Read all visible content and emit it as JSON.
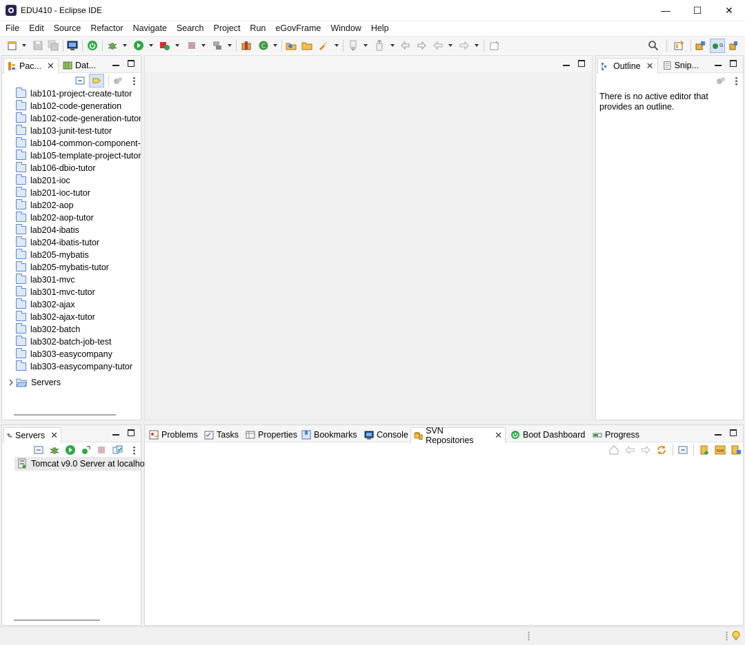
{
  "window": {
    "title": "EDU410 - Eclipse IDE",
    "minimize": "—",
    "maximize": "☐",
    "close": "✕"
  },
  "menu": [
    "File",
    "Edit",
    "Source",
    "Refactor",
    "Navigate",
    "Search",
    "Project",
    "Run",
    "eGovFrame",
    "Window",
    "Help"
  ],
  "explorer": {
    "tabs": [
      {
        "label": "Pac...",
        "icon": "package-explorer-icon"
      },
      {
        "label": "Dat...",
        "icon": "data-source-icon"
      }
    ],
    "projects": [
      "lab101-project-create-tutor",
      "lab102-code-generation",
      "lab102-code-generation-tutor",
      "lab103-junit-test-tutor",
      "lab104-common-component-",
      "lab105-template-project-tutor",
      "lab106-dbio-tutor",
      "lab201-ioc",
      "lab201-ioc-tutor",
      "lab202-aop",
      "lab202-aop-tutor",
      "lab204-ibatis",
      "lab204-ibatis-tutor",
      "lab205-mybatis",
      "lab205-mybatis-tutor",
      "lab301-mvc",
      "lab301-mvc-tutor",
      "lab302-ajax",
      "lab302-ajax-tutor",
      "lab302-batch",
      "lab302-batch-job-test",
      "lab303-easycompany",
      "lab303-easycompany-tutor"
    ],
    "servers_folder": "Servers"
  },
  "outline": {
    "tabs": [
      {
        "label": "Outline",
        "icon": "outline-icon"
      },
      {
        "label": "Snip...",
        "icon": "snippets-icon"
      }
    ],
    "message": "There is no active editor that provides an outline."
  },
  "servers_view": {
    "tab": "Servers",
    "server_entry": "Tomcat v9.0 Server at localho"
  },
  "bottom_tabs": [
    {
      "label": "Problems",
      "icon": "problems-icon"
    },
    {
      "label": "Tasks",
      "icon": "tasks-icon"
    },
    {
      "label": "Properties",
      "icon": "properties-icon"
    },
    {
      "label": "Bookmarks",
      "icon": "bookmarks-icon"
    },
    {
      "label": "Console",
      "icon": "console-icon"
    },
    {
      "label": "SVN Repositories",
      "icon": "svn-repositories-icon"
    },
    {
      "label": "Boot Dashboard",
      "icon": "boot-dashboard-icon"
    },
    {
      "label": "Progress",
      "icon": "progress-icon"
    }
  ],
  "colors": {
    "accent_green": "#2ea84a",
    "folder_blue": "#5a86c9",
    "workbench_bg": "#f0f0f0"
  }
}
